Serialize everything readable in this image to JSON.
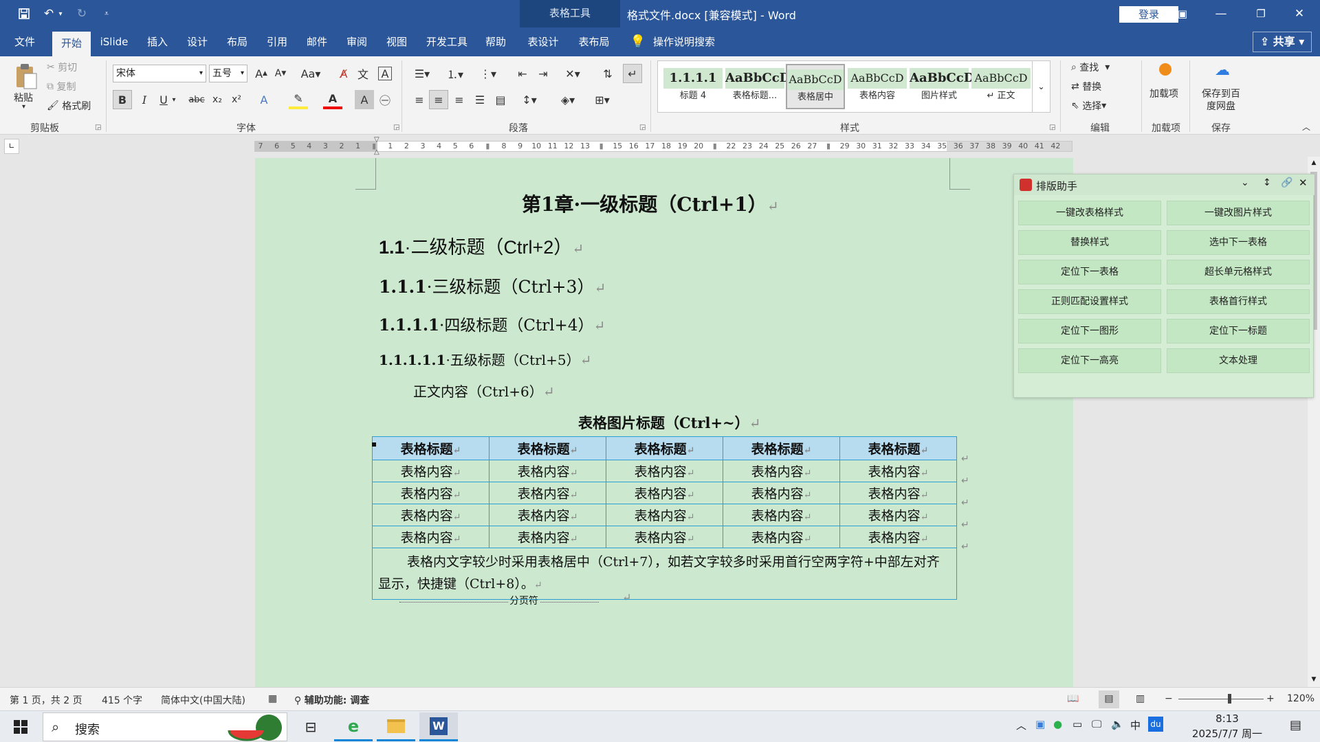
{
  "window": {
    "title": "格式文件.docx [兼容模式] - Word",
    "context_group": "表格工具",
    "login": "登录",
    "share": "共享"
  },
  "menu": {
    "tabs": [
      "文件",
      "开始",
      "iSlide",
      "插入",
      "设计",
      "布局",
      "引用",
      "邮件",
      "审阅",
      "视图",
      "开发工具",
      "帮助",
      "表设计",
      "表布局"
    ],
    "active_tab": "开始",
    "tell_me": "操作说明搜索"
  },
  "ribbon": {
    "clipboard": {
      "paste": "粘贴",
      "cut": "剪切",
      "copy": "复制",
      "format_painter": "格式刷",
      "label": "剪贴板"
    },
    "font": {
      "name": "宋体",
      "size": "五号",
      "label": "字体"
    },
    "paragraph": {
      "label": "段落"
    },
    "styles": {
      "label": "样式",
      "items": [
        {
          "sample": "1.1.1.1",
          "name": "标题 4"
        },
        {
          "sample": "AaBbCcD",
          "name": "表格标题..."
        },
        {
          "sample": "AaBbCcD",
          "name": "表格居中"
        },
        {
          "sample": "AaBbCcD",
          "name": "表格内容"
        },
        {
          "sample": "AaBbCcD",
          "name": "图片样式"
        },
        {
          "sample": "AaBbCcD",
          "name": "↵ 正文"
        }
      ],
      "selected": "表格居中"
    },
    "editing": {
      "find": "查找",
      "replace": "替换",
      "select": "选择",
      "label": "编辑"
    },
    "addins": {
      "button": "加载项",
      "label": "加载项"
    },
    "save": {
      "button": "保存到百度网盘",
      "label": "保存"
    }
  },
  "ruler": {
    "labels": [
      "7",
      "6",
      "5",
      "4",
      "3",
      "2",
      "1",
      "",
      "1",
      "2",
      "3",
      "4",
      "5",
      "6",
      "",
      "8",
      "9",
      "10",
      "11",
      "12",
      "13",
      "",
      "15",
      "16",
      "17",
      "18",
      "19",
      "20",
      "",
      "22",
      "23",
      "24",
      "25",
      "26",
      "27",
      "",
      "29",
      "30",
      "31",
      "32",
      "33",
      "34",
      "35",
      "36",
      "37",
      "38",
      "39",
      "40",
      "41",
      "42"
    ]
  },
  "document": {
    "h1": "第1章·一级标题（Ctrl+1）",
    "h2_num": "1.1",
    "h2": "·二级标题（Ctrl+2）",
    "h3_num": "1.1.1",
    "h3": "·三级标题（Ctrl+3）",
    "h4_num": "1.1.1.1",
    "h4": "·四级标题（Ctrl+4）",
    "h5_num": "1.1.1.1.1",
    "h5": "·五级标题（Ctrl+5）",
    "body": "正文内容（Ctrl+6）",
    "caption": "表格图片标题（Ctrl+~）",
    "table": {
      "headers": [
        "表格标题",
        "表格标题",
        "表格标题",
        "表格标题",
        "表格标题"
      ],
      "rows": [
        [
          "表格内容",
          "表格内容",
          "表格内容",
          "表格内容",
          "表格内容"
        ],
        [
          "表格内容",
          "表格内容",
          "表格内容",
          "表格内容",
          "表格内容"
        ],
        [
          "表格内容",
          "表格内容",
          "表格内容",
          "表格内容",
          "表格内容"
        ],
        [
          "表格内容",
          "表格内容",
          "表格内容",
          "表格内容",
          "表格内容"
        ]
      ],
      "note": "表格内文字较少时采用表格居中（Ctrl+7），如若文字较多时采用首行空两字符+中部左对齐显示，快捷键（Ctrl+8）。"
    },
    "page_break": "分页符",
    "para_mark": "↵"
  },
  "panel": {
    "title": "排版助手",
    "buttons": [
      "一键改表格样式",
      "一键改图片样式",
      "替换样式",
      "选中下一表格",
      "定位下一表格",
      "超长单元格样式",
      "正则匹配设置样式",
      "表格首行样式",
      "定位下一图形",
      "定位下一标题",
      "定位下一高亮",
      "文本处理"
    ]
  },
  "status": {
    "page": "第 1 页，共 2 页",
    "words": "415 个字",
    "language": "简体中文(中国大陆)",
    "accessibility": "辅助功能: 调查",
    "zoom": "120%",
    "zoom_level": 0.6
  },
  "taskbar": {
    "search": "搜索",
    "time": "8:13",
    "date": "2025/7/7 周一",
    "ime": "中"
  },
  "colors": {
    "word_blue": "#2b579a",
    "page_green": "#cce8cf",
    "table_border": "#2a9fd6",
    "table_header": "#b7dcf0",
    "panel_button": "#c3e6c3"
  }
}
